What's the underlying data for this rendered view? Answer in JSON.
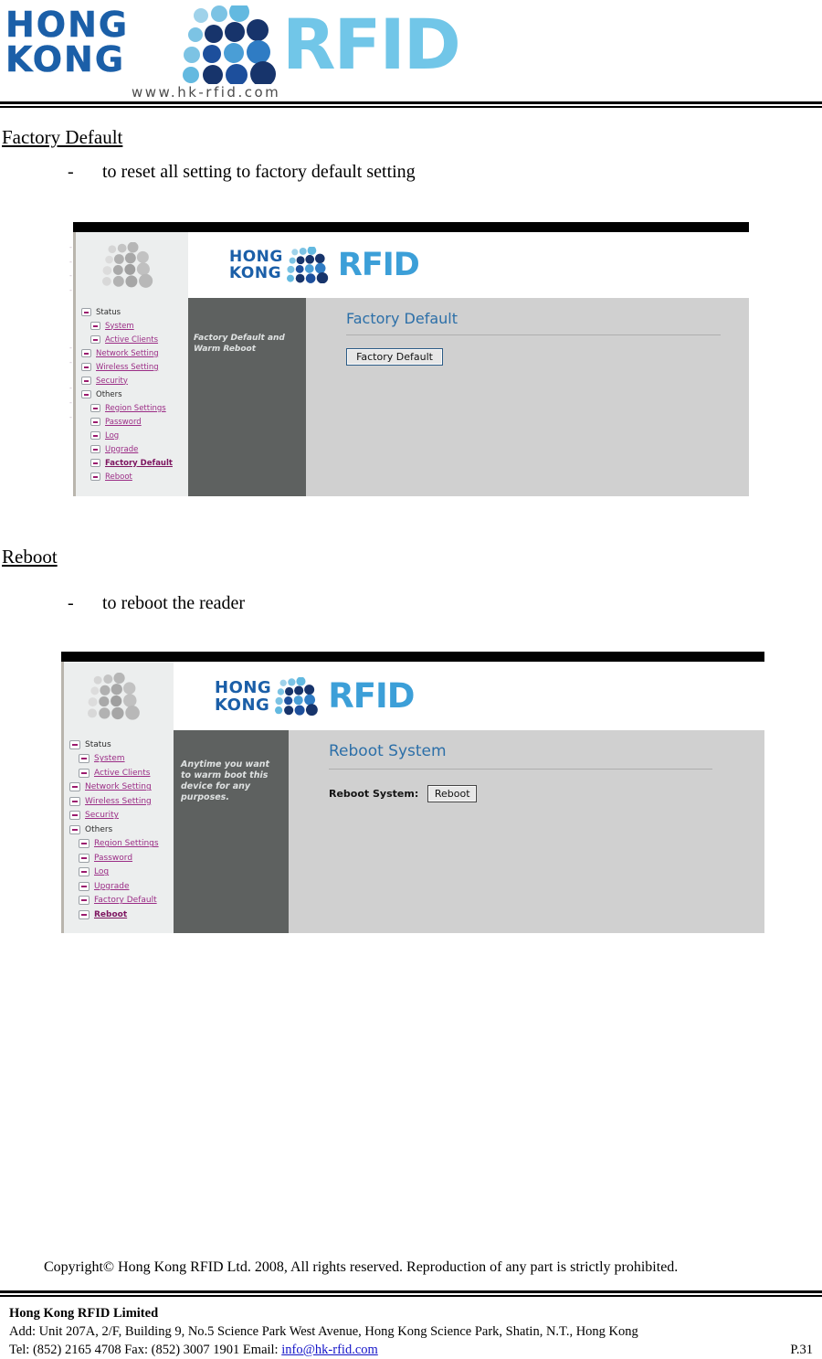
{
  "header": {
    "logo_line1": "HONG",
    "logo_line2": "KONG",
    "logo_rfid": "RFID",
    "logo_url": "www.hk-rfid.com",
    "brand_blue": "#1b5fa8",
    "brand_cyan": "#71c6e8"
  },
  "sections": [
    {
      "heading": "Factory Default",
      "dash": "-",
      "bullet": "to reset all setting to factory default setting"
    },
    {
      "heading": "Reboot",
      "dash": "-",
      "bullet": "to reboot the reader"
    }
  ],
  "screenshot_factory_default": {
    "brand": {
      "line1": "HONG",
      "line2": "KONG",
      "rfid": "RFID"
    },
    "nav": [
      {
        "label": "Status",
        "link": false,
        "level": 0,
        "current": false
      },
      {
        "label": "System",
        "link": true,
        "level": 1,
        "current": false
      },
      {
        "label": "Active Clients",
        "link": true,
        "level": 1,
        "current": false
      },
      {
        "label": "Network Setting",
        "link": true,
        "level": 0,
        "current": false
      },
      {
        "label": "Wireless Setting",
        "link": true,
        "level": 0,
        "current": false
      },
      {
        "label": "Security",
        "link": true,
        "level": 0,
        "current": false
      },
      {
        "label": "Others",
        "link": false,
        "level": 0,
        "current": false
      },
      {
        "label": "Region Settings",
        "link": true,
        "level": 1,
        "current": false
      },
      {
        "label": "Password",
        "link": true,
        "level": 1,
        "current": false
      },
      {
        "label": "Log",
        "link": true,
        "level": 1,
        "current": false
      },
      {
        "label": "Upgrade",
        "link": true,
        "level": 1,
        "current": false
      },
      {
        "label": "Factory Default",
        "link": true,
        "level": 1,
        "current": true
      },
      {
        "label": "Reboot",
        "link": true,
        "level": 1,
        "current": false
      }
    ],
    "description": "Factory Default and Warm Reboot",
    "content_title": "Factory Default",
    "button_label": "Factory Default"
  },
  "screenshot_reboot": {
    "brand": {
      "line1": "HONG",
      "line2": "KONG",
      "rfid": "RFID"
    },
    "nav": [
      {
        "label": "Status",
        "link": false,
        "level": 0,
        "current": false
      },
      {
        "label": "System",
        "link": true,
        "level": 1,
        "current": false
      },
      {
        "label": "Active Clients",
        "link": true,
        "level": 1,
        "current": false
      },
      {
        "label": "Network Setting",
        "link": true,
        "level": 0,
        "current": false
      },
      {
        "label": "Wireless Setting",
        "link": true,
        "level": 0,
        "current": false
      },
      {
        "label": "Security",
        "link": true,
        "level": 0,
        "current": false
      },
      {
        "label": "Others",
        "link": false,
        "level": 0,
        "current": false
      },
      {
        "label": "Region Settings",
        "link": true,
        "level": 1,
        "current": false
      },
      {
        "label": "Password",
        "link": true,
        "level": 1,
        "current": false
      },
      {
        "label": "Log",
        "link": true,
        "level": 1,
        "current": false
      },
      {
        "label": "Upgrade",
        "link": true,
        "level": 1,
        "current": false
      },
      {
        "label": "Factory Default",
        "link": true,
        "level": 1,
        "current": false
      },
      {
        "label": "Reboot",
        "link": true,
        "level": 1,
        "current": true
      }
    ],
    "description": "Anytime you want to warm boot this device for any purposes.",
    "content_title": "Reboot System",
    "field_label": "Reboot System:",
    "button_label": "Reboot"
  },
  "footer": {
    "copyright": "Copyright© Hong Kong RFID Ltd. 2008, All rights reserved. Reproduction of any part is strictly prohibited.",
    "company": "Hong Kong RFID Limited",
    "address": "Add: Unit 207A, 2/F, Building 9, No.5 Science Park West Avenue, Hong Kong Science Park, Shatin, N.T., Hong Kong",
    "contact_prefix": "Tel: (852) 2165 4708   Fax: (852) 3007 1901   Email: ",
    "email": "info@hk-rfid.com",
    "page_number": "P.31"
  }
}
